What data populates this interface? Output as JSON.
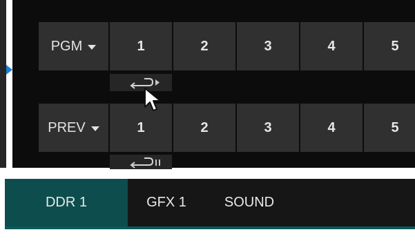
{
  "switcher": {
    "program_bus": {
      "label": "PGM",
      "sources": [
        "1",
        "2",
        "3",
        "4",
        "5"
      ]
    },
    "preview_bus": {
      "label": "PREV",
      "sources": [
        "1",
        "2",
        "3",
        "4",
        "5"
      ]
    }
  },
  "tabs": [
    {
      "label": "DDR 1",
      "active": true
    },
    {
      "label": "GFX 1",
      "active": false
    },
    {
      "label": "SOUND",
      "active": false
    }
  ],
  "colors": {
    "accent_marker": "#1b7fd6",
    "active_tab": "#0e4d4d",
    "button_bg": "#303030",
    "panel_bg": "#0c0c0c"
  },
  "icons": {
    "pgm_transition_control": "return-arrow-play-icon",
    "prev_transition_control": "return-arrow-pause-icon",
    "bus_menu": "chevron-down-icon",
    "pointer": "mouse-cursor-icon"
  }
}
